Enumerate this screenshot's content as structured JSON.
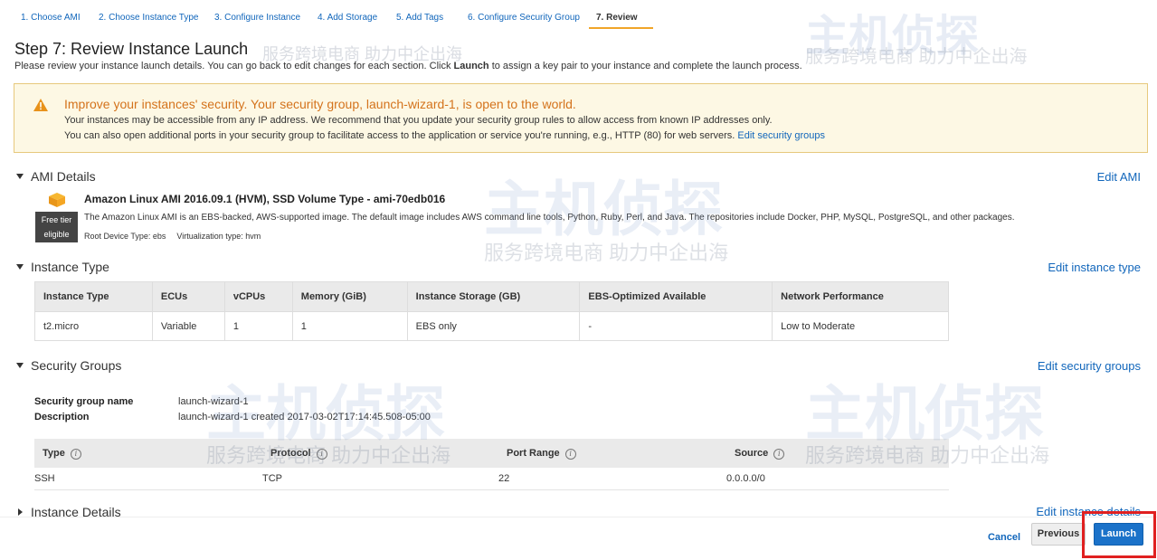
{
  "wizard": {
    "tabs": [
      {
        "label": "1. Choose AMI"
      },
      {
        "label": "2. Choose Instance Type"
      },
      {
        "label": "3. Configure Instance"
      },
      {
        "label": "4. Add Storage"
      },
      {
        "label": "5. Add Tags"
      },
      {
        "label": "6. Configure Security Group"
      },
      {
        "label": "7. Review"
      }
    ],
    "active_index": 6,
    "accent_color": "#f0a528"
  },
  "header": {
    "title": "Step 7: Review Instance Launch",
    "subtitle_pre": "Please review your instance launch details. You can go back to edit changes for each section. Click ",
    "subtitle_bold": "Launch",
    "subtitle_post": " to assign a key pair to your instance and complete the launch process."
  },
  "warning": {
    "icon": "warning-triangle-icon",
    "title": "Improve your instances' security. Your security group, launch-wizard-1, is open to the world.",
    "line1": "Your instances may be accessible from any IP address. We recommend that you update your security group rules to allow access from known IP addresses only.",
    "line2": "You can also open additional ports in your security group to facilitate access to the application or service you're running, e.g., HTTP (80) for web servers.",
    "link": "Edit security groups"
  },
  "ami": {
    "heading": "AMI Details",
    "edit": "Edit AMI",
    "name": "Amazon Linux AMI 2016.09.1 (HVM), SSD Volume Type - ami-70edb016",
    "badge_line1": "Free tier",
    "badge_line2": "eligible",
    "description": "The Amazon Linux AMI is an EBS-backed, AWS-supported image. The default image includes AWS command line tools, Python, Ruby, Perl, and Java. The repositories include Docker, PHP, MySQL, PostgreSQL, and other packages.",
    "root_device": "Root Device Type: ebs",
    "virtualization": "Virtualization type: hvm"
  },
  "instance_type": {
    "heading": "Instance Type",
    "edit": "Edit instance type",
    "columns": [
      "Instance Type",
      "ECUs",
      "vCPUs",
      "Memory (GiB)",
      "Instance Storage (GB)",
      "EBS-Optimized Available",
      "Network Performance"
    ],
    "rows": [
      [
        "t2.micro",
        "Variable",
        "1",
        "1",
        "EBS only",
        "-",
        "Low to Moderate"
      ]
    ]
  },
  "security_groups": {
    "heading": "Security Groups",
    "edit": "Edit security groups",
    "name_label": "Security group name",
    "name_value": "launch-wizard-1",
    "desc_label": "Description",
    "desc_value": "launch-wizard-1 created 2017-03-02T17:14:45.508-05:00",
    "columns": [
      "Type",
      "Protocol",
      "Port Range",
      "Source"
    ],
    "rows": [
      [
        "SSH",
        "TCP",
        "22",
        "0.0.0.0/0"
      ]
    ]
  },
  "instance_details": {
    "heading": "Instance Details",
    "edit": "Edit instance details"
  },
  "footer": {
    "cancel": "Cancel",
    "previous": "Previous",
    "launch": "Launch",
    "launch_color": "#1b72c9"
  },
  "watermark": {
    "logo_text": "主机侦探",
    "tagline": "服务跨境电商 助力中企出海"
  }
}
